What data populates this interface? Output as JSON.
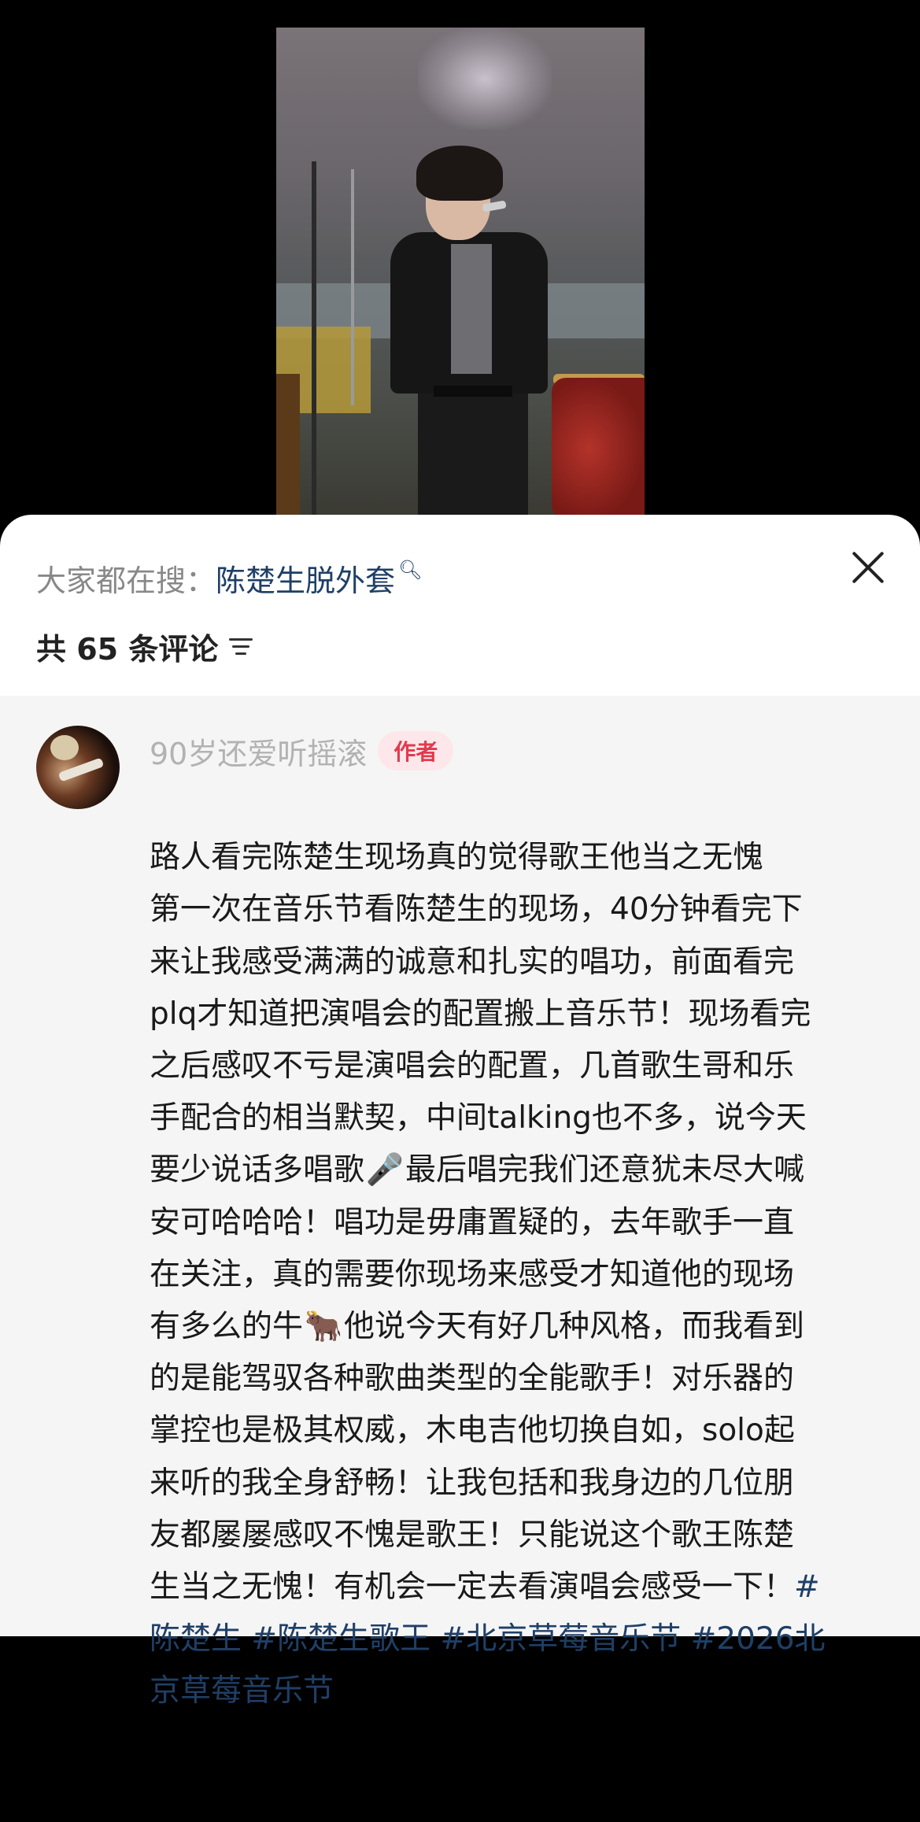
{
  "video": {
    "description_icon": "concert-video-frame"
  },
  "search_bar": {
    "prefix": "大家都在搜：",
    "term": "陈楚生脱外套",
    "term_icon": "search-icon"
  },
  "close_icon": "close-icon",
  "comments_header": {
    "count_label": "共 65 条评论",
    "sort_icon": "sort-icon"
  },
  "comment": {
    "username": "90岁还爱听摇滚",
    "badge": "作者",
    "lines": [
      "路人看完陈楚生现场真的觉得歌王他当之无愧",
      "第一次在音乐节看陈楚生的现场，40分钟看完下",
      "来让我感受满满的诚意和扎实的唱功，前面看完",
      "plq才知道把演唱会的配置搬上音乐节！现场看完",
      "之后感叹不亏是演唱会的配置，几首歌生哥和乐",
      "手配合的相当默契，中间talking也不多，说今天"
    ],
    "line7_a": "要少说话多唱歌",
    "emoji_mic": "🎤",
    "line7_b": "最后唱完我们还意犹未尽大喊",
    "line8": "安可哈哈哈！唱功是毋庸置疑的，去年歌手一直",
    "line9": "在关注，真的需要你现场来感受才知道他的现场",
    "line10_a": "有多么的牛",
    "emoji_ox": "🐂",
    "line10_b": "他说今天有好几种风格，而我看到",
    "lines_b": [
      "的是能驾驭各种歌曲类型的全能歌手！对乐器的",
      "掌控也是极其权威，木电吉他切换自如，solo起",
      "来听的我全身舒畅！让我包括和我身边的几位朋",
      "友都屡屡感叹不愧是歌王！只能说这个歌王陈楚"
    ],
    "line15_text": "生当之无愧！有机会一定去看演唱会感受一下！",
    "line15_hash": "#",
    "tags_line1": [
      "陈楚生",
      "#陈楚生歌王",
      "#北京草莓音乐节",
      "#2026北"
    ],
    "tags_line2": "京草莓音乐节"
  }
}
